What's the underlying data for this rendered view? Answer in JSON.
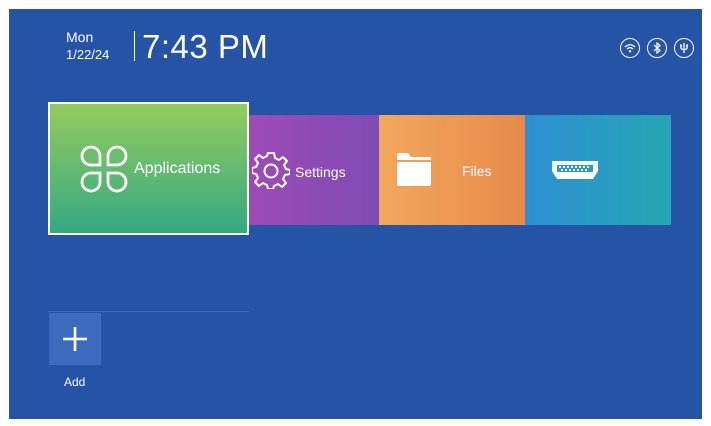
{
  "status_bar": {
    "day": "Mon",
    "date": "1/22/24",
    "time": "7:43 PM",
    "icons": [
      "wifi-icon",
      "bluetooth-icon",
      "usb-icon"
    ]
  },
  "tiles": [
    {
      "label": "Applications",
      "icon": "apps-grid-icon",
      "color": "#5dbb6e",
      "selected": true
    },
    {
      "label": "Settings",
      "icon": "gear-icon",
      "color": "#8c4cb5"
    },
    {
      "label": "Files",
      "icon": "folder-icon",
      "color": "#ee9a55"
    },
    {
      "label": "",
      "icon": "hdmi-icon",
      "color": "#2a9bc4"
    }
  ],
  "shortcuts": [
    {
      "label": "Add",
      "icon": "plus-icon"
    }
  ],
  "colors": {
    "background": "#2553a5",
    "focus_border": "#ffffff",
    "add_tile": "#3c6bbd"
  }
}
